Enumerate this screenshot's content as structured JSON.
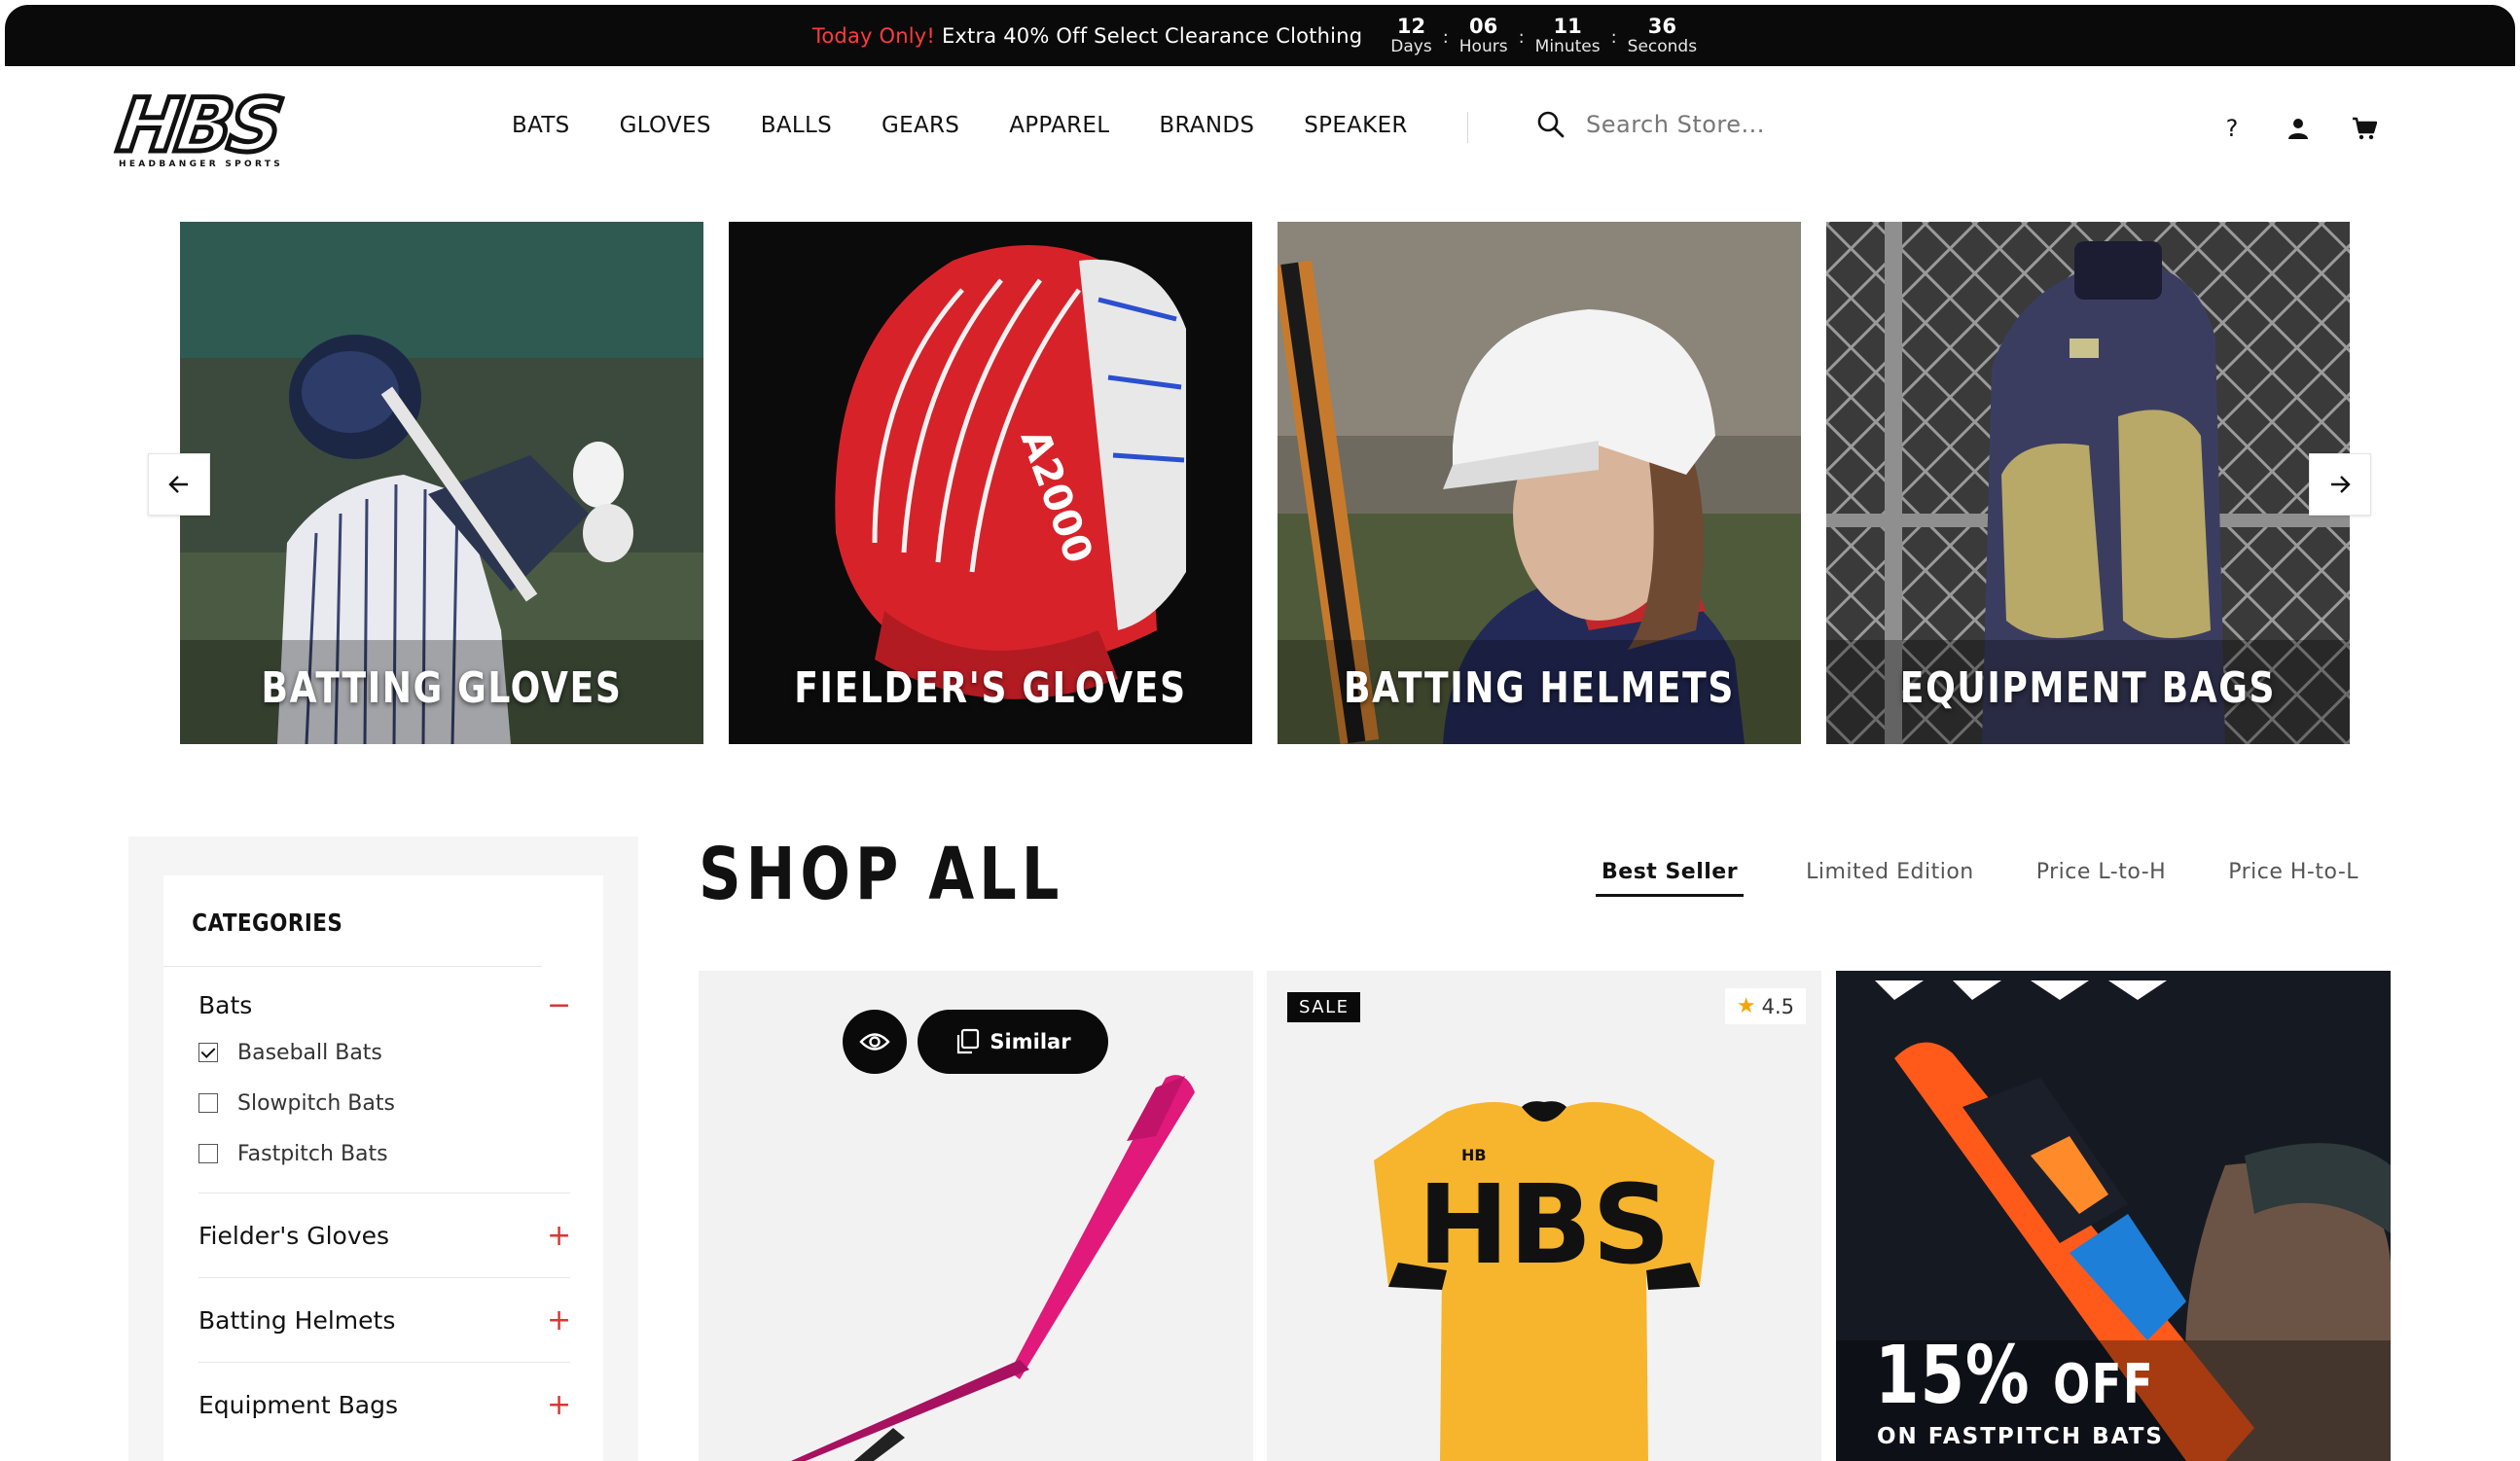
{
  "announcement": {
    "highlight": "Today Only!",
    "text": "Extra 40% Off Select Clearance Clothing",
    "countdown": [
      {
        "value": "12",
        "label": "Days"
      },
      {
        "value": "06",
        "label": "Hours"
      },
      {
        "value": "11",
        "label": "Minutes"
      },
      {
        "value": "36",
        "label": "Seconds"
      }
    ]
  },
  "brand": {
    "logo_text": "HBS",
    "tagline": "HEADBANGER SPORTS"
  },
  "nav": [
    "BATS",
    "GLOVES",
    "BALLS",
    "GEARS",
    "APPAREL",
    "BRANDS",
    "SPEAKER"
  ],
  "search": {
    "placeholder": "Search Store..."
  },
  "header_icons": {
    "help": "?",
    "help_icon": "question-icon",
    "account_icon": "user-icon",
    "cart_icon": "cart-icon"
  },
  "carousel": {
    "tiles": [
      "BATTING GLOVES",
      "FIELDER'S GLOVES",
      "BATTING HELMETS",
      "EQUIPMENT BAGS"
    ],
    "prev_icon": "arrow-left-icon",
    "next_icon": "arrow-right-icon"
  },
  "sidebar": {
    "title": "CATEGORIES",
    "groups": [
      {
        "label": "Bats",
        "expanded": true,
        "toggle": "−",
        "items": [
          {
            "label": "Baseball Bats",
            "checked": true
          },
          {
            "label": "Slowpitch Bats",
            "checked": false
          },
          {
            "label": "Fastpitch Bats",
            "checked": false
          }
        ]
      },
      {
        "label": "Fielder's Gloves",
        "expanded": false,
        "toggle": "+"
      },
      {
        "label": "Batting Helmets",
        "expanded": false,
        "toggle": "+"
      },
      {
        "label": "Equipment Bags",
        "expanded": false,
        "toggle": "+"
      }
    ]
  },
  "shop": {
    "title": "SHOP ALL",
    "sort_tabs": [
      "Best Seller",
      "Limited Edition",
      "Price L-to-H",
      "Price H-to-L"
    ],
    "active_sort": "Best Seller"
  },
  "products": {
    "card1": {
      "quick_view_icon": "eye-icon",
      "similar_label": "Similar",
      "similar_icon": "copy-icon"
    },
    "card2": {
      "badge": "SALE",
      "rating": "4.5",
      "rating_icon": "star-icon"
    },
    "card3": {
      "promo_number": "15%",
      "promo_word": "OFF",
      "promo_sub": "ON FASTPITCH BATS"
    }
  },
  "colors": {
    "accent_red": "#ff3b3b",
    "toggle_red": "#d93636",
    "black": "#0a0a0a",
    "rating_star": "#f4a700"
  }
}
